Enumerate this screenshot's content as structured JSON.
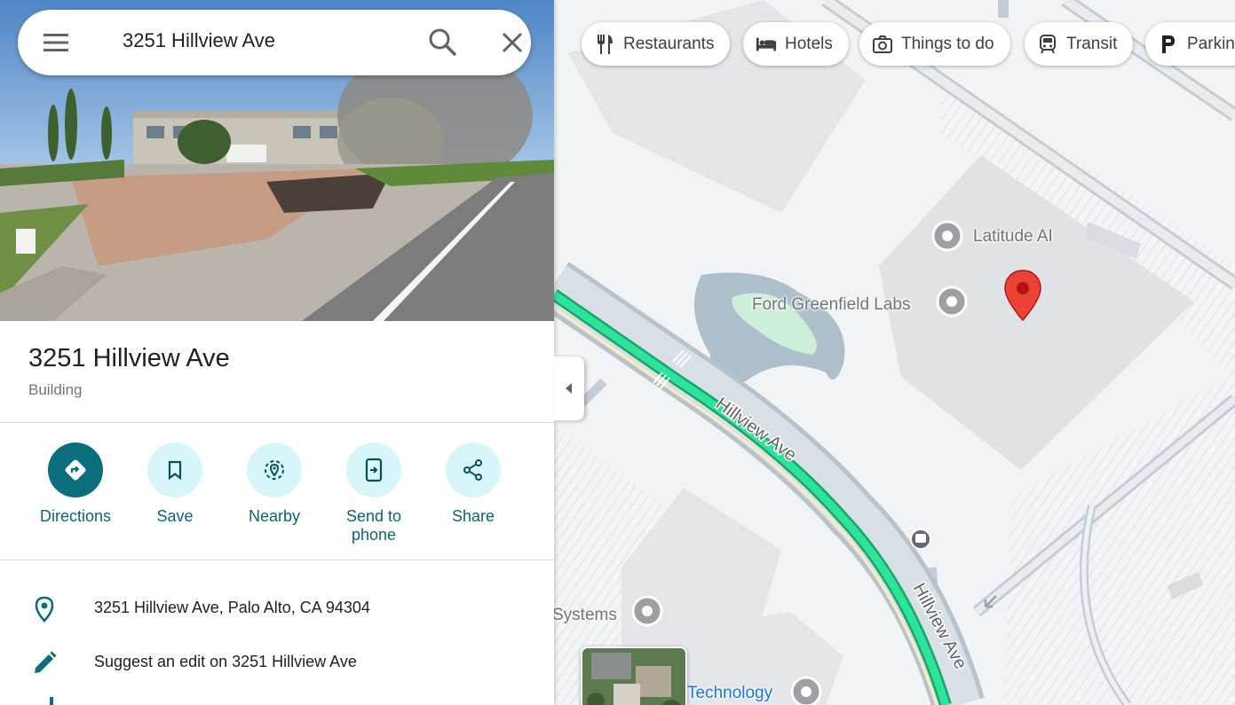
{
  "search": {
    "query": "3251 Hillview Ave"
  },
  "place": {
    "title": "3251 Hillview Ave",
    "type": "Building"
  },
  "actions": [
    {
      "label": "Directions",
      "icon": "directions-icon"
    },
    {
      "label": "Save",
      "icon": "bookmark-icon"
    },
    {
      "label": "Nearby",
      "icon": "nearby-icon"
    },
    {
      "label": "Send to phone",
      "icon": "send-to-phone-icon"
    },
    {
      "label": "Share",
      "icon": "share-icon"
    }
  ],
  "info": {
    "address": "3251 Hillview Ave, Palo Alto, CA 94304",
    "suggest_edit": "Suggest an edit on 3251 Hillview Ave"
  },
  "chips": [
    {
      "label": "Restaurants",
      "icon": "fork-knife-icon"
    },
    {
      "label": "Hotels",
      "icon": "bed-icon"
    },
    {
      "label": "Things to do",
      "icon": "camera-icon"
    },
    {
      "label": "Transit",
      "icon": "train-icon"
    },
    {
      "label": "Parking",
      "icon": "parking-icon"
    }
  ],
  "map": {
    "pois": {
      "latitude_ai": "Latitude AI",
      "ford_greenfield": "Ford Greenfield Labs",
      "systems": "Systems",
      "technology": "Technology"
    },
    "road_label": "Hillview Ave",
    "colors": {
      "route": "#1ed68c",
      "road": "#b7c3cc",
      "water": "#aebfcc",
      "park": "#cdeed8",
      "pin": "#ea4335",
      "accent": "#0b6e7c"
    }
  }
}
